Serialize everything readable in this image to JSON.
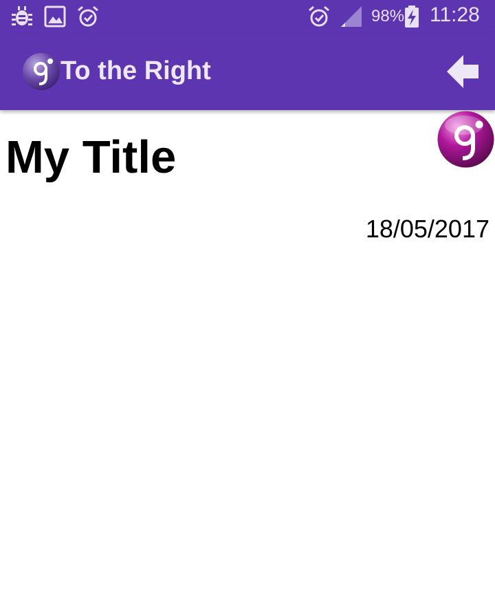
{
  "status_bar": {
    "battery": "98%",
    "time": "11:28",
    "left_icons": [
      "bug-icon",
      "image-icon",
      "alarm-icon"
    ],
    "right_icons": [
      "alarm-icon",
      "signal-icon",
      "battery-charging-icon"
    ]
  },
  "app_bar": {
    "title": "To the Right",
    "logo_icon": "app-logo-icon",
    "back_icon": "arrow-back-icon",
    "background_color": "#5e35b1"
  },
  "content": {
    "title": "My Title",
    "date": "18/05/2017",
    "logo_icon": "app-logo-icon",
    "logo_color": "#b0179b"
  }
}
